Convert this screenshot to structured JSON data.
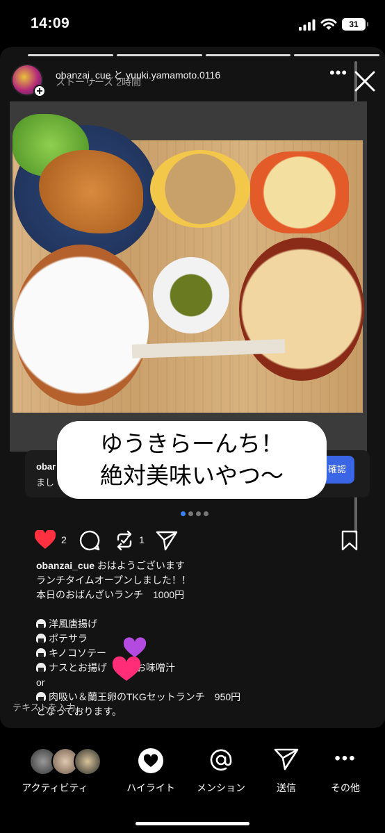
{
  "status_bar": {
    "time": "14:09",
    "battery": "31"
  },
  "story": {
    "users": "obanzai_cue と yuuki.yamamoto.0116",
    "overlay_text": "ストーリーズ  2時間",
    "sticker_lines": [
      "ゆうきらーんち！",
      "絶対美味いやつ〜"
    ],
    "ad_name": "obar",
    "ad_sub": "まし",
    "ad_button": "確認",
    "likes": "2",
    "reposts": "1",
    "caption_user": "obanzai_cue",
    "caption_lines": [
      "おはようございます",
      "ランチタイムオープンしました！！",
      "本日のおばんざいランチ　1000円",
      "",
      "洋風唐揚げ",
      "ポテサラ",
      "キノコソテー",
      "ナスとお揚げ　　　お味噌汁",
      "or",
      "肉吸い＆蘭王卵のTKGセットランチ　950円",
      "となっております。"
    ],
    "input_hint": "テキストを入力..."
  },
  "tabbar": {
    "items": [
      {
        "label": "アクティビティ",
        "icon": "avatar-stack-icon"
      },
      {
        "label": "ハイライト",
        "icon": "heart-circle-icon"
      },
      {
        "label": "メンション",
        "icon": "at-icon"
      },
      {
        "label": "送信",
        "icon": "send-icon"
      },
      {
        "label": "その他",
        "icon": "more-icon"
      }
    ]
  },
  "colors": {
    "like_red": "#ff3040",
    "accent_blue": "#3b82f6"
  }
}
